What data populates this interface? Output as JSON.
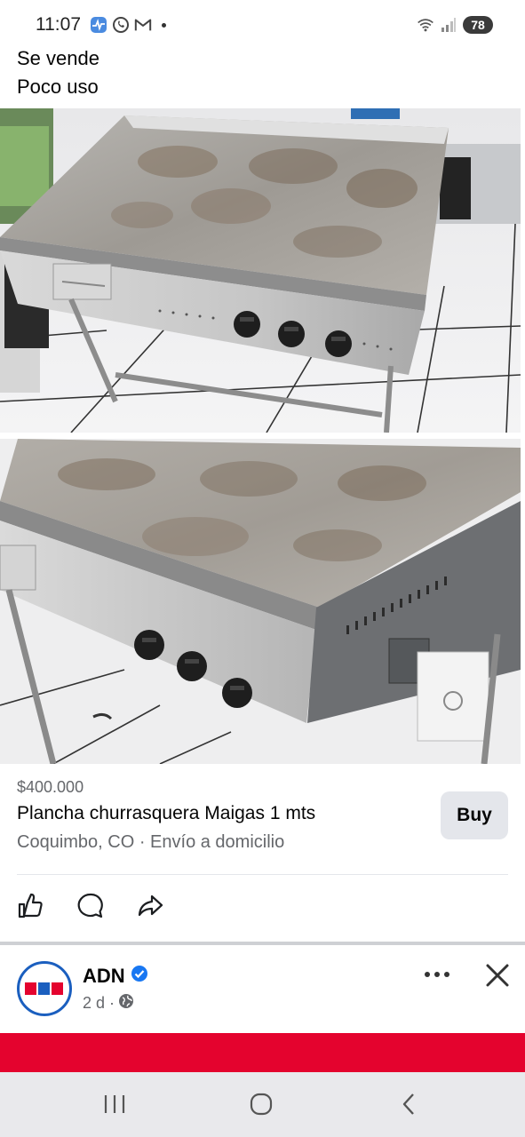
{
  "status": {
    "time": "11:07",
    "battery": "78",
    "icons": [
      "health-app-icon",
      "whatsapp-icon",
      "gmail-icon",
      "notification-dot",
      "wifi-icon",
      "signal-icon"
    ]
  },
  "post": {
    "caption_line1": "Se vende",
    "caption_line2": "Poco uso",
    "photos": [
      "griddle-photo-front",
      "griddle-photo-angle"
    ]
  },
  "listing": {
    "price": "$400.000",
    "title": "Plancha churrasquera Maigas 1 mts",
    "location": "Coquimbo, CO · Envío a domicilio",
    "buy_label": "Buy"
  },
  "actions": {
    "icons": [
      "like-icon",
      "comment-icon",
      "share-icon"
    ]
  },
  "next_post": {
    "page_name": "ADN",
    "avatar_text": "ADN",
    "time": "2 d ·",
    "verified": true
  },
  "colors": {
    "accent_blue": "#1b5fbf",
    "verified_blue": "#1877f2",
    "banner_red": "#e4032e",
    "secondary_text": "#65676b",
    "button_gray": "#e4e6eb"
  },
  "nav": {
    "icons": [
      "recents-icon",
      "home-icon",
      "back-icon"
    ]
  }
}
